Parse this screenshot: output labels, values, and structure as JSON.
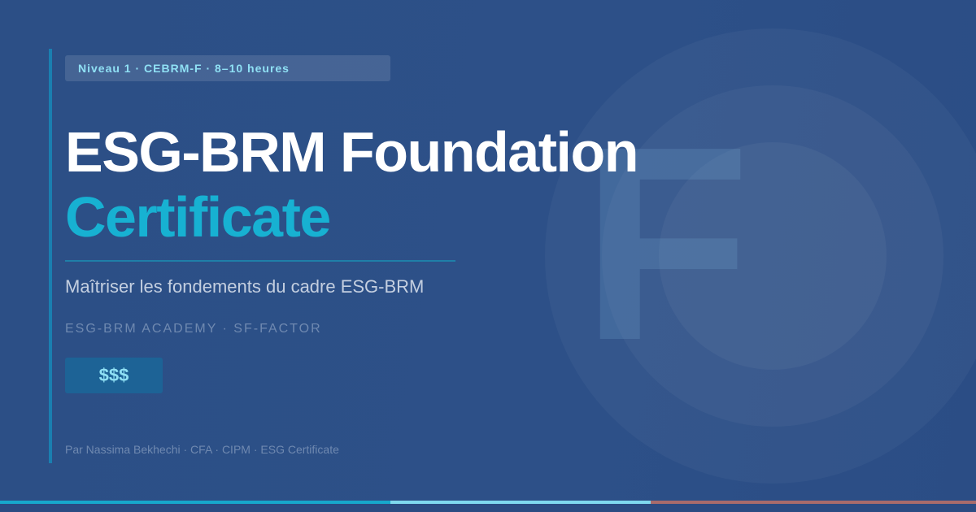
{
  "badge": {
    "text": "Niveau 1 · CEBRM-F · 8–10 heures"
  },
  "hero": {
    "title": "ESG-BRM Foundation",
    "title_accent": "Certificate",
    "tagline": "Maîtriser les fondements du cadre ESG-BRM",
    "watermark_letter": "F"
  },
  "brands": {
    "line": "ESG-BRM ACADEMY  ·  SF-FACTOR"
  },
  "price": {
    "label": "$$$"
  },
  "author": {
    "line": "Par Nassima Bekhechi · CFA · CIPM · ESG Certificate"
  },
  "colors": {
    "background": "#2c4e86",
    "accent": "#17b1d2",
    "badge_text": "#8fe0f4",
    "stripe": [
      "#17a8cc",
      "#7fd8ee",
      "#a86b6b"
    ]
  }
}
